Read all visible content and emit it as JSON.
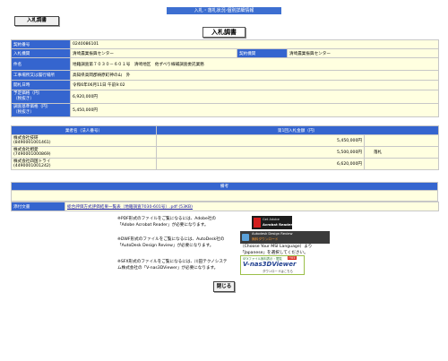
{
  "header": {
    "title": "入札・落札状況-個別詳細情報"
  },
  "tab": {
    "label": "入札調書"
  },
  "page_title": "入札調書",
  "contract": {
    "rows": [
      {
        "label": "契約番号",
        "value": "0240086101"
      },
      {
        "label": "入札機関",
        "value": "清崎農業振興センター",
        "label2": "契約機関",
        "value2": "清崎農業振興センター"
      },
      {
        "label": "件名",
        "value": "地籍調査第７０３０－６０１号　清崎地区　他ずべり線補調査委託業務"
      },
      {
        "label": "工事場所又は履行場所",
        "value": "高知県高岡郡梼原町神の山　外"
      },
      {
        "label": "開札日時",
        "value": "令和6年06月11日 午前9:02"
      },
      {
        "label": "予定価格（円）",
        "label_sub": "（税抜き）",
        "value": "6,920,000円"
      },
      {
        "label": "調査基準価格（円）",
        "label_sub": "（税抜き）",
        "value": "5,450,000円"
      }
    ]
  },
  "bidders": {
    "col_name": "業者名（法人番号）",
    "col_amount": "第1回入札金額（円）",
    "rows": [
      {
        "name": "株式会社技研",
        "number": "(8490001001461)",
        "amount": "5,450,000円",
        "note": ""
      },
      {
        "name": "株式会社相愛",
        "number": "(7490001000869)",
        "amount": "5,500,000円",
        "note": "落札"
      },
      {
        "name": "株式会社四国トライ",
        "number": "(4490001001242)",
        "amount": "6,620,000円",
        "note": ""
      }
    ]
  },
  "remarks": {
    "label": "備考"
  },
  "attachment": {
    "label": "添付文書",
    "link": "総合評価方式評価結果一覧表（地籍調査7030-601号）.pdf (53KB)"
  },
  "notices": {
    "pdf": "※PDF形式のファイルをご覧になるには、Adobe社の「Adobe Acrobat Reader」が必要になります。",
    "dwf": "※DWF形式のファイルをご覧になるには、AutoDesk社の「AutoDesk Design Review」が必要になります。",
    "dwf_note": "（Choose Your MSI Language）より「Japanese」を選択してください。",
    "sfx": "※SFX形式のファイルをご覧になるには、川田テクノシステム株式会社の「V-nas3DViewer」が必要になります。"
  },
  "logos": {
    "adobe_small": "Get Adobe",
    "adobe_main": "Acrobat Reader",
    "autodesk_small": "Autodesk Design Review",
    "autodesk_sub": "無料ダウンロード",
    "vnas_top": "SFXファイル無料表示・閲覧",
    "vnas_badge": "FREE",
    "vnas_main": "V-nas3DViewer",
    "vnas_sub": "ダウンロードはこちら"
  },
  "close_button": "閉じる"
}
